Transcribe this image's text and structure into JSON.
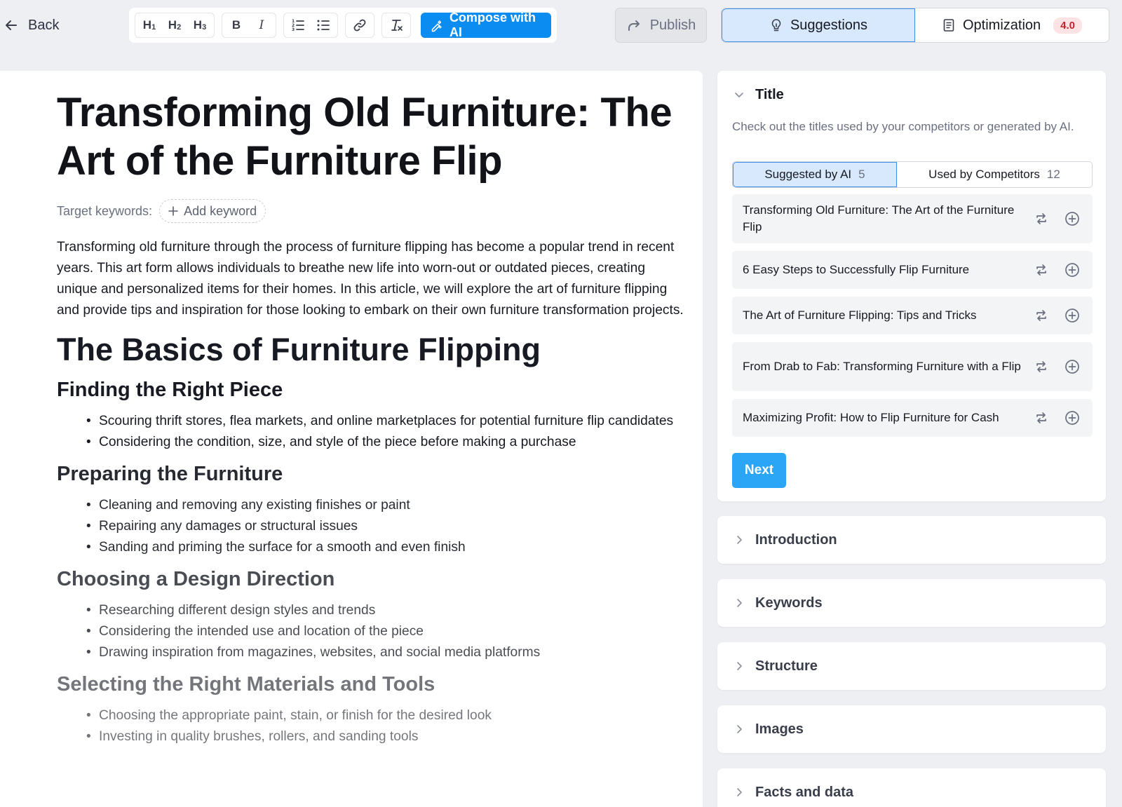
{
  "topbar": {
    "back_label": "Back",
    "toolbar": {
      "h1": "H",
      "h1_sub": "1",
      "h2": "H",
      "h2_sub": "2",
      "h3": "H",
      "h3_sub": "3",
      "bold": "B",
      "italic": "I",
      "compose_label": "Compose with AI"
    },
    "publish_label": "Publish",
    "tabs": {
      "suggestions": "Suggestions",
      "optimization": "Optimization",
      "optimization_score": "4.0"
    }
  },
  "article": {
    "title": "Transforming Old Furniture: The Art of the Furniture Flip",
    "keywords_label": "Target keywords:",
    "add_keyword": "Add keyword",
    "intro": "Transforming old furniture through the process of furniture flipping has become a popular trend in recent years. This art form allows individuals to breathe new life into worn-out or outdated pieces, creating unique and personalized items for their homes. In this article, we will explore the art of furniture flipping and provide tips and inspiration for those looking to embark on their own furniture transformation projects.",
    "h2": "The Basics of Furniture Flipping",
    "sections": [
      {
        "heading": "Finding the Right Piece",
        "bullets": [
          "Scouring thrift stores, flea markets, and online marketplaces for potential furniture flip candidates",
          "Considering the condition, size, and style of the piece before making a purchase"
        ]
      },
      {
        "heading": "Preparing the Furniture",
        "bullets": [
          "Cleaning and removing any existing finishes or paint",
          "Repairing any damages or structural issues",
          "Sanding and priming the surface for a smooth and even finish"
        ]
      },
      {
        "heading": "Choosing a Design Direction",
        "bullets": [
          "Researching different design styles and trends",
          "Considering the intended use and location of the piece",
          "Drawing inspiration from magazines, websites, and social media platforms"
        ]
      },
      {
        "heading": "Selecting the Right Materials and Tools",
        "bullets": [
          "Choosing the appropriate paint, stain, or finish for the desired look",
          "Investing in quality brushes, rollers, and sanding tools"
        ]
      }
    ]
  },
  "panel": {
    "title_section": {
      "heading": "Title",
      "description": "Check out the titles used by your competitors or generated by AI.",
      "seg_ai_label": "Suggested by AI",
      "seg_ai_count": "5",
      "seg_comp_label": "Used by Competitors",
      "seg_comp_count": "12",
      "suggestions": [
        "Transforming Old Furniture: The Art of the Furniture Flip",
        "6 Easy Steps to Successfully Flip Furniture",
        "The Art of Furniture Flipping: Tips and Tricks",
        "From Drab to Fab: Transforming Furniture with a Flip",
        "Maximizing Profit: How to Flip Furniture for Cash"
      ],
      "next_label": "Next"
    },
    "collapsed_sections": [
      "Introduction",
      "Keywords",
      "Structure",
      "Images",
      "Facts and data"
    ]
  },
  "colors": {
    "accent": "#0b8cf0",
    "next_button": "#2ba5f5",
    "selected_tab_bg": "#d8e9fd",
    "score_text": "#c7232d",
    "score_bg": "#fde3e3"
  },
  "icons": {
    "back": "arrow-left-icon",
    "ordered_list": "ordered-list-icon",
    "bullet_list": "bullet-list-icon",
    "link": "link-icon",
    "clear_format": "clear-format-icon",
    "compose": "magic-pen-icon",
    "publish": "share-arrow-icon",
    "suggestions": "lightbulb-icon",
    "optimization": "document-icon",
    "replace": "replace-icon",
    "add": "plus-circle-icon",
    "chevron_down": "chevron-down-icon",
    "chevron_right": "chevron-right-icon"
  }
}
